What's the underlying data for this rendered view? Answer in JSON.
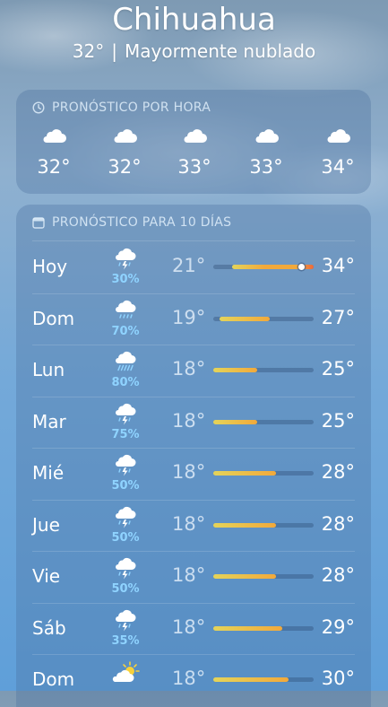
{
  "header": {
    "city": "Chihuahua",
    "current_temp": "32°",
    "separator": "|",
    "condition": "Mayormente nublado"
  },
  "hourly": {
    "title": "PRONÓSTICO POR HORA",
    "title_icon": "clock-icon",
    "items": [
      {
        "icon": "cloud-icon",
        "temp": "32°"
      },
      {
        "icon": "cloud-icon",
        "temp": "32°"
      },
      {
        "icon": "cloud-icon",
        "temp": "33°"
      },
      {
        "icon": "cloud-icon",
        "temp": "33°"
      },
      {
        "icon": "cloud-icon",
        "temp": "34°"
      }
    ]
  },
  "daily": {
    "title": "PRONÓSTICO PARA 10 DÍAS",
    "title_icon": "calendar-icon",
    "range_scale": {
      "min": 18,
      "max": 34
    },
    "days": [
      {
        "day": "Hoy",
        "icon": "thunderstorm-icon",
        "pop": "30%",
        "low": "21°",
        "high": "34°",
        "low_val": 21,
        "high_val": 34,
        "current_val": 32
      },
      {
        "day": "Dom",
        "icon": "rain-icon",
        "pop": "70%",
        "low": "19°",
        "high": "27°",
        "low_val": 19,
        "high_val": 27
      },
      {
        "day": "Lun",
        "icon": "heavy-rain-icon",
        "pop": "80%",
        "low": "18°",
        "high": "25°",
        "low_val": 18,
        "high_val": 25
      },
      {
        "day": "Mar",
        "icon": "thunderstorm-icon",
        "pop": "75%",
        "low": "18°",
        "high": "25°",
        "low_val": 18,
        "high_val": 25
      },
      {
        "day": "Mié",
        "icon": "thunderstorm-icon",
        "pop": "50%",
        "low": "18°",
        "high": "28°",
        "low_val": 18,
        "high_val": 28
      },
      {
        "day": "Jue",
        "icon": "thunderstorm-icon",
        "pop": "50%",
        "low": "18°",
        "high": "28°",
        "low_val": 18,
        "high_val": 28
      },
      {
        "day": "Vie",
        "icon": "thunderstorm-icon",
        "pop": "50%",
        "low": "18°",
        "high": "28°",
        "low_val": 18,
        "high_val": 28
      },
      {
        "day": "Sáb",
        "icon": "thunderstorm-icon",
        "pop": "35%",
        "low": "18°",
        "high": "29°",
        "low_val": 18,
        "high_val": 29
      },
      {
        "day": "Dom",
        "icon": "partly-sunny-icon",
        "pop": "",
        "low": "18°",
        "high": "30°",
        "low_val": 18,
        "high_val": 30
      }
    ]
  },
  "colors": {
    "pop_blue": "#8fd3ff",
    "range_cool": "#e4d45a",
    "range_warm": "#f2a93b",
    "range_hot": "#ec6a3c"
  }
}
